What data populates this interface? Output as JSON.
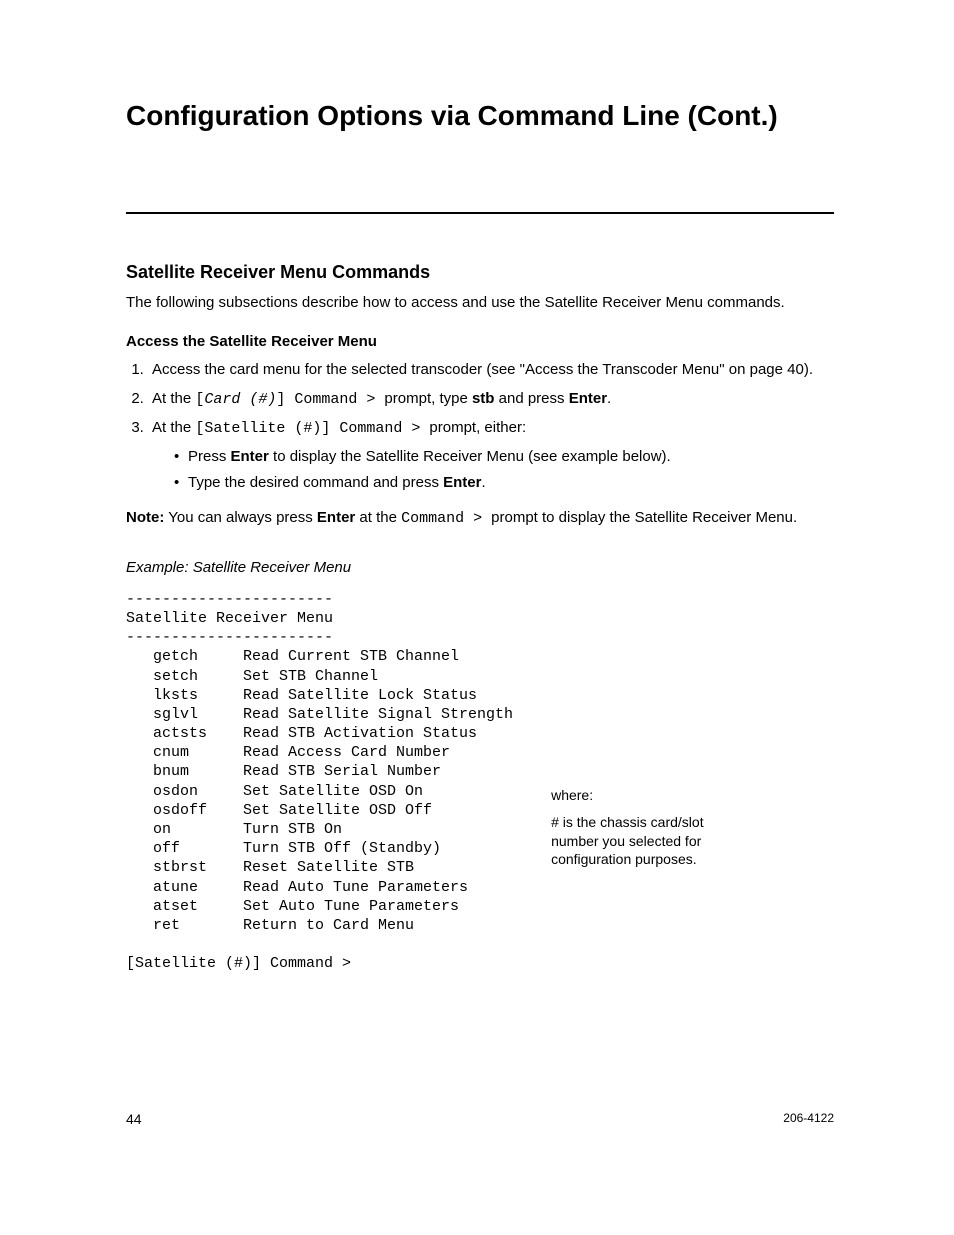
{
  "title": "Configuration Options via Command Line (Cont.)",
  "section": {
    "heading": "Satellite Receiver Menu Commands",
    "intro": "The following subsections describe how to access and use the Satellite Receiver Menu commands."
  },
  "subsection": {
    "heading": "Access the Satellite Receiver Menu",
    "step1": "Access the card menu for the selected transcoder (see \"Access the Transcoder Menu\" on page 40).",
    "step2_pre": "At the ",
    "step2_code_open": "[",
    "step2_code_card": "Card (#)",
    "step2_code_close": "] Command > ",
    "step2_mid": "prompt, type ",
    "step2_cmd": "stb",
    "step2_mid2": " and press ",
    "step2_enter": "Enter",
    "step2_end": ".",
    "step3_pre": "At the ",
    "step3_code": "[Satellite (#)] Command > ",
    "step3_mid": "prompt, either:",
    "step3a_pre": "Press ",
    "step3a_enter": "Enter",
    "step3a_post": " to display the Satellite Receiver Menu (see example below).",
    "step3b_pre": "Type the desired command and press ",
    "step3b_enter": "Enter",
    "step3b_post": "."
  },
  "note": {
    "label": "Note:",
    "pre": " You can always press ",
    "enter": "Enter",
    "mid": " at the ",
    "code": "Command > ",
    "post": " prompt to display the Satellite Receiver Menu."
  },
  "example": {
    "title": "Example: Satellite Receiver Menu",
    "menu": "-----------------------\nSatellite Receiver Menu\n-----------------------\n   getch     Read Current STB Channel\n   setch     Set STB Channel\n   lksts     Read Satellite Lock Status\n   sglvl     Read Satellite Signal Strength\n   actsts    Read STB Activation Status\n   cnum      Read Access Card Number\n   bnum      Read STB Serial Number\n   osdon     Set Satellite OSD On\n   osdoff    Set Satellite OSD Off\n   on        Turn STB On\n   off       Turn STB Off (Standby)\n   stbrst    Reset Satellite STB\n   atune     Read Auto Tune Parameters\n   atset     Set Auto Tune Parameters\n   ret       Return to Card Menu\n\n[Satellite (#)] Command >"
  },
  "aside": {
    "where": "where:",
    "text": "# is the chassis card/slot number you selected for configuration purposes."
  },
  "footer": {
    "page": "44",
    "docref": "206-4122"
  }
}
